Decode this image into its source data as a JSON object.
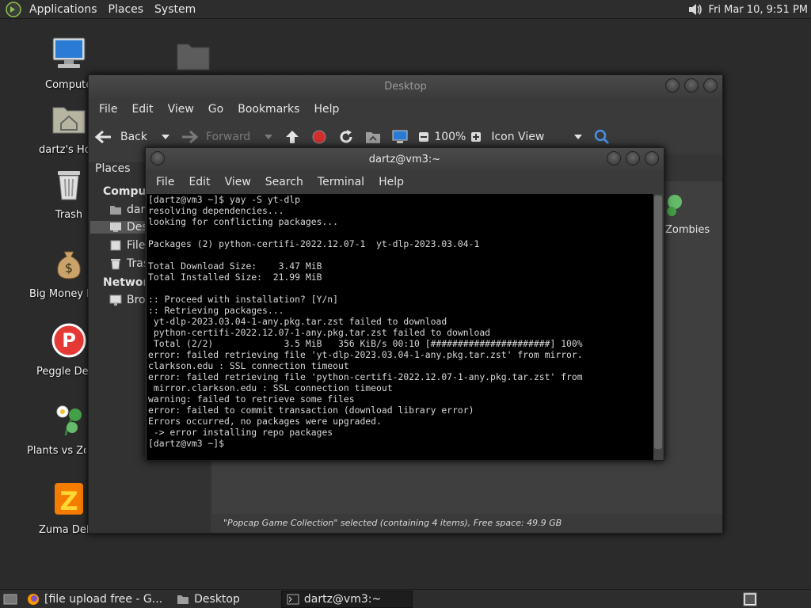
{
  "top_panel": {
    "menu": [
      "Applications",
      "Places",
      "System"
    ],
    "clock": "Fri Mar 10,  9:51 PM"
  },
  "desktop_icons": [
    {
      "label": "Computer"
    },
    {
      "label": "dartz's Home"
    },
    {
      "label": "Trash"
    },
    {
      "label": "Big Money Deluxe"
    },
    {
      "label": "Peggle Deluxe"
    },
    {
      "label": "Plants vs Zombies"
    },
    {
      "label": "Zuma Deluxe"
    }
  ],
  "file_manager": {
    "title": "Desktop",
    "menu": [
      "File",
      "Edit",
      "View",
      "Go",
      "Bookmarks",
      "Help"
    ],
    "toolbar": {
      "back": "Back",
      "forward": "Forward",
      "zoom": "100%",
      "view_mode": "Icon View"
    },
    "sidebar": {
      "header": "Places",
      "items": [
        {
          "label": "Computer",
          "kind": "header"
        },
        {
          "label": "dartz"
        },
        {
          "label": "Desktop",
          "selected": true
        },
        {
          "label": "File System"
        },
        {
          "label": "Trash"
        },
        {
          "label": "Network",
          "kind": "header"
        },
        {
          "label": "Browse Network"
        }
      ]
    },
    "content_partial_label": "Zombies",
    "status": "\"Popcap Game Collection\" selected (containing 4 items), Free space: 49.9 GB"
  },
  "terminal": {
    "title": "dartz@vm3:~",
    "menu": [
      "File",
      "Edit",
      "View",
      "Search",
      "Terminal",
      "Help"
    ],
    "output": "[dartz@vm3 ~]$ yay -S yt-dlp\nresolving dependencies...\nlooking for conflicting packages...\n\nPackages (2) python-certifi-2022.12.07-1  yt-dlp-2023.03.04-1\n\nTotal Download Size:    3.47 MiB\nTotal Installed Size:  21.99 MiB\n\n:: Proceed with installation? [Y/n]\n:: Retrieving packages...\n yt-dlp-2023.03.04-1-any.pkg.tar.zst failed to download\n python-certifi-2022.12.07-1-any.pkg.tar.zst failed to download\n Total (2/2)             3.5 MiB   356 KiB/s 00:10 [######################] 100%\nerror: failed retrieving file 'yt-dlp-2023.03.04-1-any.pkg.tar.zst' from mirror.\nclarkson.edu : SSL connection timeout\nerror: failed retrieving file 'python-certifi-2022.12.07-1-any.pkg.tar.zst' from\n mirror.clarkson.edu : SSL connection timeout\nwarning: failed to retrieve some files\nerror: failed to commit transaction (download library error)\nErrors occurred, no packages were upgraded.\n -> error installing repo packages\n[dartz@vm3 ~]$"
  },
  "taskbar": {
    "tasks": [
      {
        "label": "[file upload free - G..."
      },
      {
        "label": "Desktop"
      },
      {
        "label": "dartz@vm3:~",
        "active": true
      }
    ]
  }
}
